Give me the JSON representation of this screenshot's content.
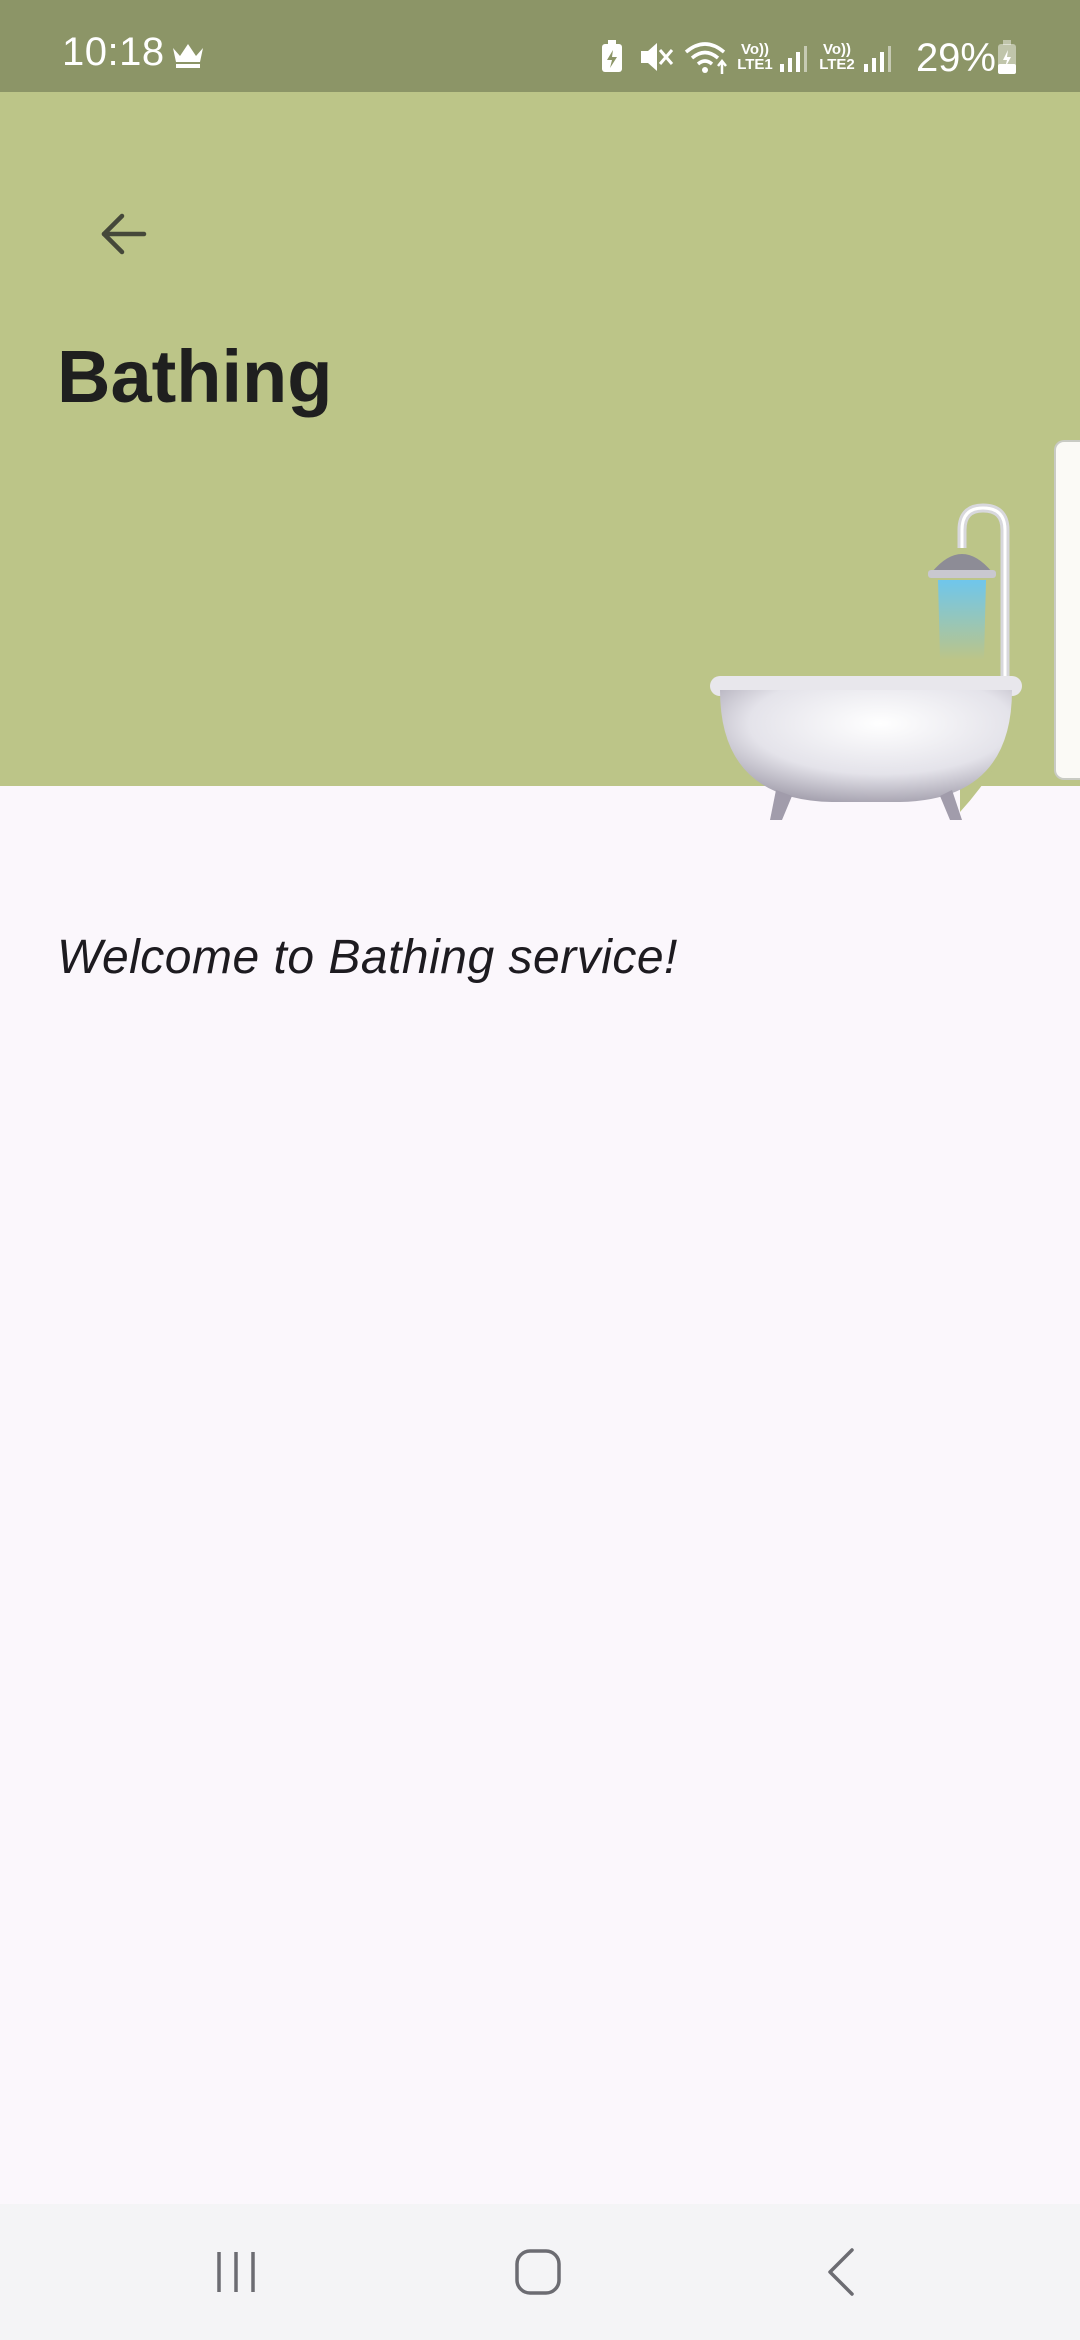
{
  "status_bar": {
    "time": "10:18",
    "battery_percent": "29%",
    "sim1_label_top": "Vo))",
    "sim1_label_bottom": "LTE1",
    "sim2_label_top": "Vo))",
    "sim2_label_bottom": "LTE2",
    "icons": [
      "crown-icon",
      "battery-saver-icon",
      "mute-icon",
      "wifi-icon",
      "signal-icon",
      "battery-icon"
    ]
  },
  "header": {
    "title": "Bathing",
    "back_icon": "arrow-left-icon",
    "illustration": "bathtub-icon",
    "background_color": "#bcc588"
  },
  "main": {
    "welcome_text": "Welcome to Bathing service!"
  },
  "nav_bar": {
    "buttons": [
      "recent-apps-icon",
      "home-icon",
      "back-icon"
    ]
  }
}
